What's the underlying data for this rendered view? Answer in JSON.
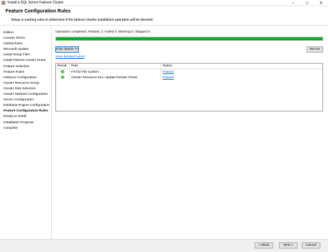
{
  "window": {
    "title": "Install a SQL Server Failover Cluster"
  },
  "header": {
    "title": "Feature Configuration Rules",
    "description": "Setup is running rules to determine if the failover cluster installation operation will be blocked."
  },
  "sidebar": {
    "items": [
      {
        "label": "Edition"
      },
      {
        "label": "License Terms"
      },
      {
        "label": "Global Rules"
      },
      {
        "label": "Microsoft Update"
      },
      {
        "label": "Install Setup Files"
      },
      {
        "label": "Install Failover Cluster Rules"
      },
      {
        "label": "Feature Selection"
      },
      {
        "label": "Feature Rules"
      },
      {
        "label": "Instance Configuration"
      },
      {
        "label": "Cluster Resource Group"
      },
      {
        "label": "Cluster Disk Selection"
      },
      {
        "label": "Cluster Network Configuration"
      },
      {
        "label": "Server Configuration"
      },
      {
        "label": "Database Engine Configuration"
      },
      {
        "label": "Feature Configuration Rules"
      },
      {
        "label": "Ready to Install"
      },
      {
        "label": "Installation Progress"
      },
      {
        "label": "Complete"
      }
    ],
    "active_index": 14
  },
  "main": {
    "status_text": "Operation completed. Passed: 2.   Failed 0.   Warning 0.   Skipped 0.",
    "progress": 1.0,
    "hide_details_label": "Hide details <<",
    "rerun_label": "Re-run",
    "view_report_label": "View detailed report",
    "columns": {
      "result": "Result",
      "rule": "Rule",
      "status": "Status"
    },
    "rows": [
      {
        "rule": "FAT32 File System",
        "status": "Passed"
      },
      {
        "rule": "Cluster Resource DLL Update Restart Check",
        "status": "Passed"
      }
    ]
  },
  "footer": {
    "back_label": "< Back",
    "next_label": "Next >",
    "cancel_label": "Cancel"
  },
  "colors": {
    "progress_fill": "#06b025",
    "passed_icon": "#2e9e2e",
    "link": "#0066cc"
  },
  "icons": {
    "app": "sql-setup-icon",
    "result": "check-circle-icon"
  }
}
